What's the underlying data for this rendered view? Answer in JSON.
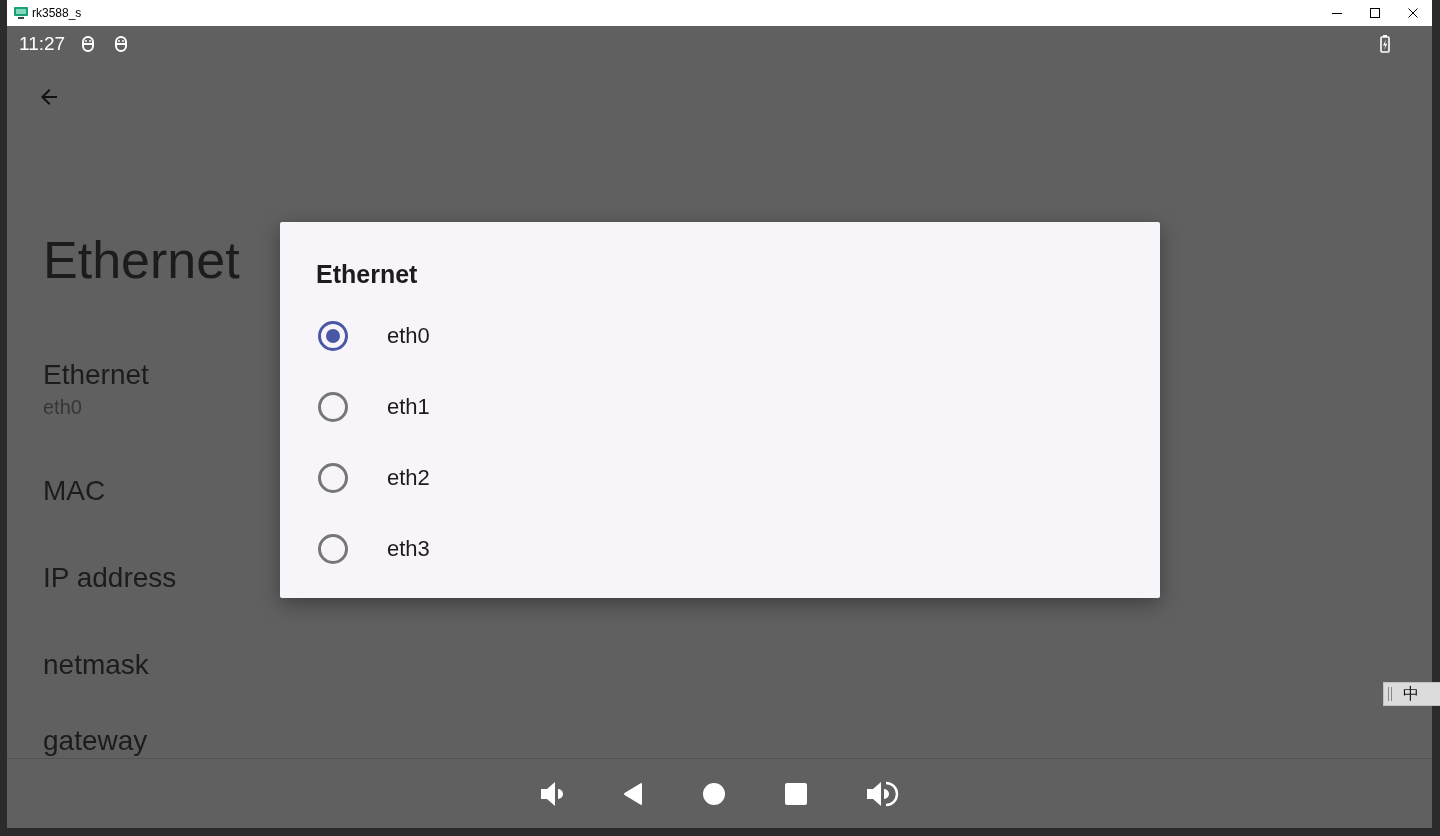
{
  "window": {
    "title": "rk3588_s"
  },
  "status_bar": {
    "time": "11:27"
  },
  "page": {
    "title": "Ethernet",
    "items": [
      {
        "title": "Ethernet",
        "summary": "eth0"
      },
      {
        "title": "MAC"
      },
      {
        "title": "IP address"
      },
      {
        "title": "netmask"
      },
      {
        "title": "gateway"
      }
    ]
  },
  "dialog": {
    "title": "Ethernet",
    "options": [
      {
        "label": "eth0",
        "selected": true
      },
      {
        "label": "eth1",
        "selected": false
      },
      {
        "label": "eth2",
        "selected": false
      },
      {
        "label": "eth3",
        "selected": false
      }
    ]
  },
  "ime_toolbar": {
    "mode": "中"
  }
}
